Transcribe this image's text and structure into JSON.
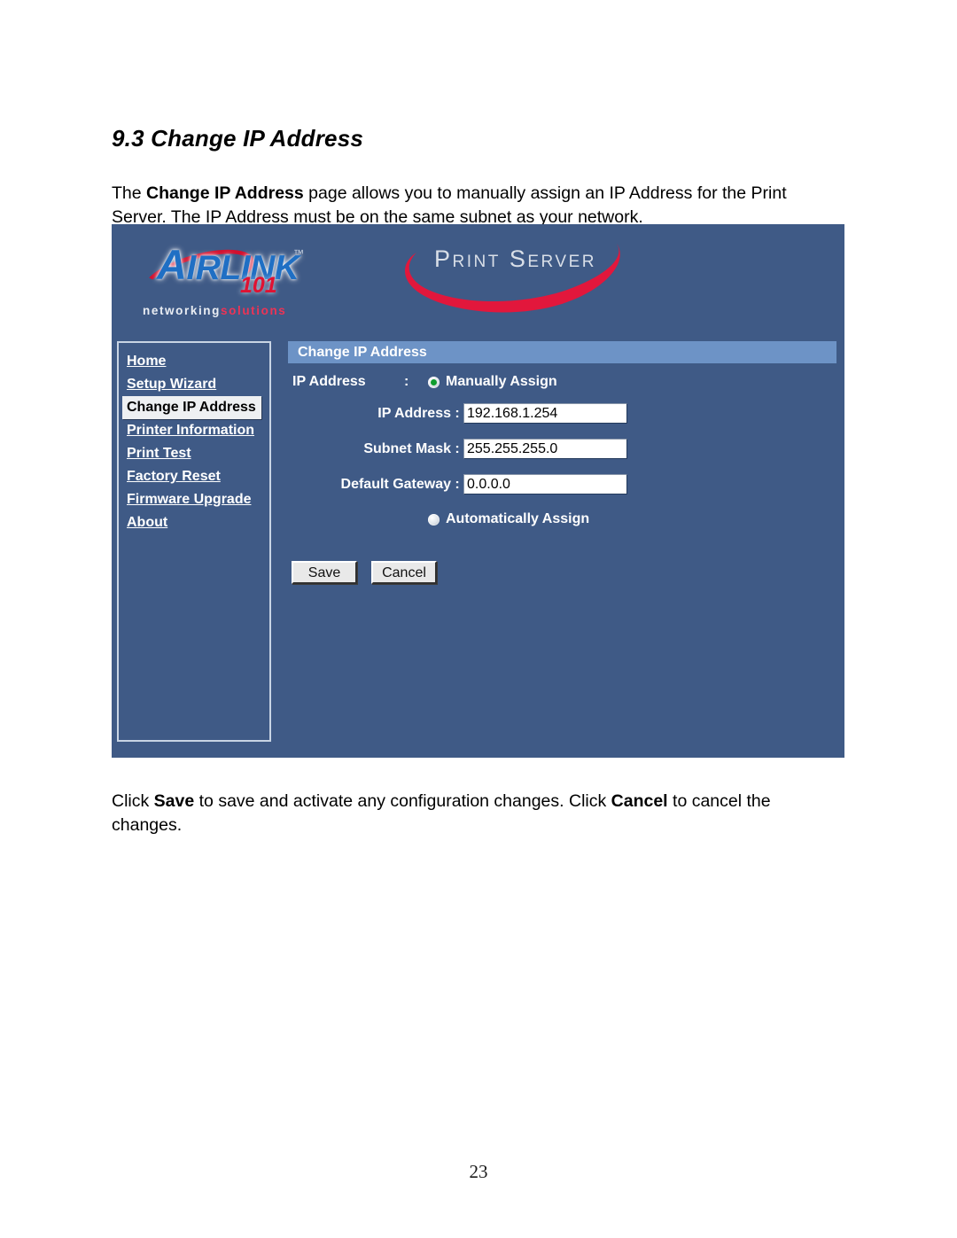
{
  "document": {
    "heading": "9.3 Change IP Address",
    "intro_before": "The ",
    "intro_bold": "Change IP Address",
    "intro_after": " page allows you to manually assign an IP Address for the Print Server. The IP Address must be on the same subnet as your network.",
    "closing_1": "Click ",
    "closing_bold_1": "Save",
    "closing_2": " to save and activate any configuration changes. Click ",
    "closing_bold_2": "Cancel",
    "closing_3": " to cancel the changes.",
    "page_number": "23"
  },
  "screenshot": {
    "brand": {
      "logo_cap": "A",
      "logo_rest": "IRLINK",
      "logo_tm": "™",
      "logo_101": "101",
      "tagline_networking": "networking",
      "tagline_solutions": "solutions",
      "product_title": "Print Server"
    },
    "sidebar": {
      "items": [
        {
          "label": "Home",
          "active": false
        },
        {
          "label": "Setup Wizard",
          "active": false
        },
        {
          "label": "Change IP Address",
          "active": true
        },
        {
          "label": "Printer Information",
          "active": false
        },
        {
          "label": "Print Test",
          "active": false
        },
        {
          "label": "Factory Reset",
          "active": false
        },
        {
          "label": "Firmware Upgrade",
          "active": false
        },
        {
          "label": "About",
          "active": false
        }
      ]
    },
    "content": {
      "title": "Change IP Address",
      "ip_address_label": "IP Address",
      "colon": ":",
      "radio_manual": "Manually Assign",
      "radio_auto": "Automatically Assign",
      "manual_selected": true,
      "fields": [
        {
          "label": "IP Address",
          "colon": ":",
          "value": "192.168.1.254"
        },
        {
          "label": "Subnet Mask",
          "colon": ":",
          "value": "255.255.255.0"
        },
        {
          "label": "Default Gateway",
          "colon": ":",
          "value": "0.0.0.0"
        }
      ],
      "save_label": "Save",
      "cancel_label": "Cancel"
    },
    "colors": {
      "panel_background": "#3f5a86",
      "title_bar": "#6d93c6",
      "brand_blue": "#1f6fc4",
      "brand_red": "#d2102e",
      "radio_selected": "#0f9c2e",
      "active_nav_background": "#eef0f2"
    }
  }
}
